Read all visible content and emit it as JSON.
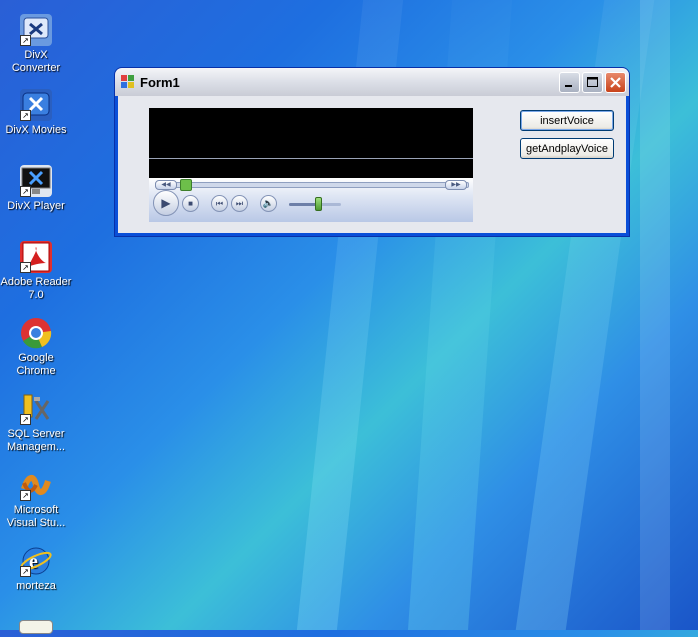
{
  "desktop": {
    "icons": [
      {
        "label": "DivX Converter",
        "icon": "divx-converter-icon",
        "color": "#4a7fd0"
      },
      {
        "label": "DivX Movies",
        "icon": "divx-movies-icon",
        "color": "#2a5fc0"
      },
      {
        "label": "DivX Player",
        "icon": "divx-player-icon",
        "color": "#1a1a1a"
      },
      {
        "label": "Adobe Reader 7.0",
        "icon": "adobe-reader-icon",
        "color": "#d42020"
      },
      {
        "label": "Google Chrome",
        "icon": "chrome-icon",
        "color": "#3a9a3a"
      },
      {
        "label": "SQL Server Managem...",
        "icon": "sql-server-icon",
        "color": "#c8a020"
      },
      {
        "label": "Microsoft Visual Stu...",
        "icon": "visual-studio-icon",
        "color": "#e08a20"
      },
      {
        "label": "morteza",
        "icon": "internet-explorer-icon",
        "color": "#2a7fe0"
      }
    ]
  },
  "window": {
    "title": "Form1",
    "buttons": {
      "insert_label": "insertVoice",
      "get_play_label": "getAndplayVoice"
    },
    "player": {
      "volume_fraction": 0.55,
      "seek_fraction": 0.1
    }
  },
  "colors": {
    "title_close": "#c8421a",
    "window_frame": "#0a4fd8"
  }
}
